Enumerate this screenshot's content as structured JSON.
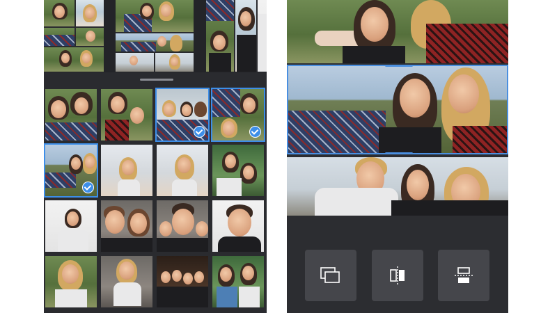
{
  "left_panel": {
    "layout_options": [
      {
        "name": "layout-grid-6"
      },
      {
        "name": "layout-grid-5"
      },
      {
        "name": "layout-columns-3"
      }
    ],
    "photos": [
      {
        "scene": "grass",
        "selected": false
      },
      {
        "scene": "grass",
        "selected": false
      },
      {
        "scene": "window",
        "selected": true
      },
      {
        "scene": "grass",
        "selected": true
      },
      {
        "scene": "field",
        "selected": true
      },
      {
        "scene": "beach",
        "selected": false
      },
      {
        "scene": "beach",
        "selected": false
      },
      {
        "scene": "green",
        "selected": false
      },
      {
        "scene": "white",
        "selected": false
      },
      {
        "scene": "indoor",
        "selected": false
      },
      {
        "scene": "indoor",
        "selected": false
      },
      {
        "scene": "white",
        "selected": false
      },
      {
        "scene": "grass",
        "selected": false
      },
      {
        "scene": "indoor",
        "selected": false
      },
      {
        "scene": "bar",
        "selected": false
      },
      {
        "scene": "green",
        "selected": false
      }
    ]
  },
  "right_panel": {
    "collage_strips": [
      "strip-top",
      "strip-mid",
      "strip-bot"
    ],
    "selected_strip": "strip-mid",
    "tools": [
      {
        "name": "replace-button",
        "icon": "replace-icon"
      },
      {
        "name": "mirror-button",
        "icon": "mirror-icon"
      },
      {
        "name": "flip-button",
        "icon": "flip-icon"
      }
    ]
  },
  "colors": {
    "accent": "#3d8ee8",
    "panel_bg": "#2a2b2f",
    "tool_button_bg": "#45464b"
  }
}
